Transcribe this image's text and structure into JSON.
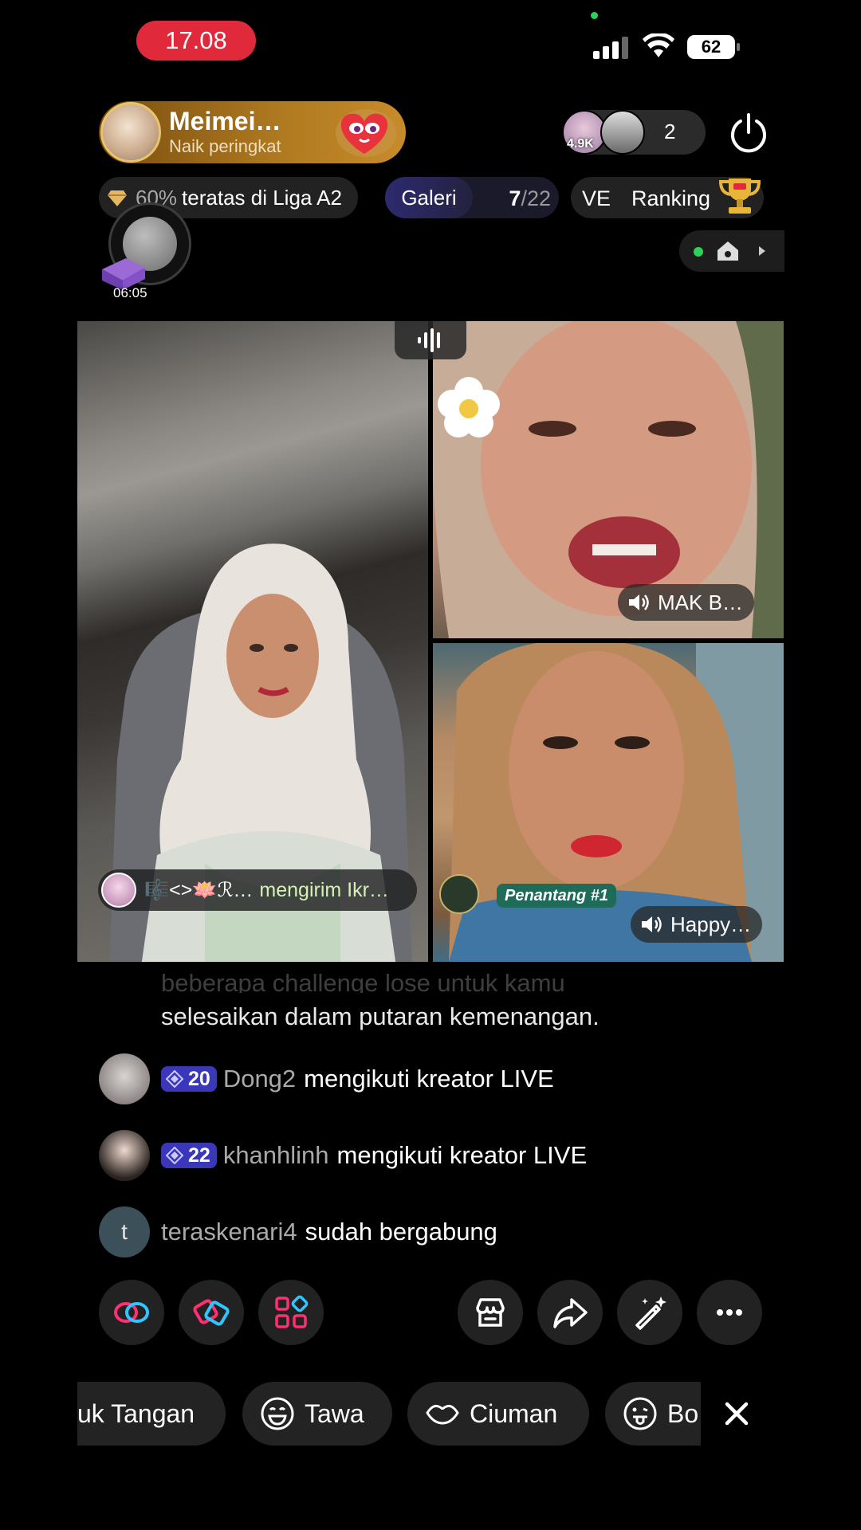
{
  "status_bar": {
    "time": "17.08",
    "battery": "62"
  },
  "host": {
    "name": "Meimei…",
    "subtitle": "Naik peringkat"
  },
  "viewers": {
    "badge": "4.9K",
    "count": "2"
  },
  "league": {
    "percent": "60%",
    "label": "teratas di Liga A2"
  },
  "gallery": {
    "label": "Galeri",
    "current": "7",
    "total": "/22"
  },
  "ranking": {
    "prefix": "VE",
    "label": "Ranking"
  },
  "floating_widget": {
    "timer": "06:05"
  },
  "video": {
    "gift_banner": {
      "sender": "🎼<>🪷ℛ…",
      "action": "mengirim Ikr…"
    },
    "guest1_name": "MAK B…",
    "guest2_name": "Happy…",
    "challenger_label": "Penantang #1"
  },
  "chat": {
    "faded_line": "beberapa challenge lose untuk kamu",
    "line0": "selesaikan dalam putaran kemenangan.",
    "rows": [
      {
        "level": "20",
        "user": "Dong2",
        "message": "mengikuti kreator LIVE"
      },
      {
        "level": "22",
        "user": "khanhlinh",
        "message": "mengikuti kreator LIVE"
      },
      {
        "initial": "t",
        "user": "teraskenari4",
        "message": "sudah bergabung"
      }
    ]
  },
  "reactions": [
    "uk Tangan",
    "Tawa",
    "Ciuman",
    "Bo"
  ],
  "colors": {
    "live_red": "#e0293a",
    "gold": "#b07a20",
    "level_blue": "#3a37b8",
    "challenger_green": "#1f6b5a"
  }
}
